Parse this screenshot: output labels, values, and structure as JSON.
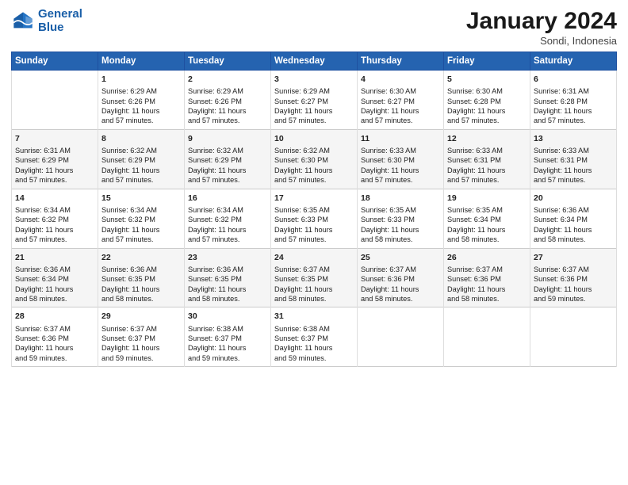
{
  "logo": {
    "line1": "General",
    "line2": "Blue"
  },
  "title": "January 2024",
  "subtitle": "Sondi, Indonesia",
  "days_header": [
    "Sunday",
    "Monday",
    "Tuesday",
    "Wednesday",
    "Thursday",
    "Friday",
    "Saturday"
  ],
  "weeks": [
    [
      {
        "day": "",
        "data": ""
      },
      {
        "day": "1",
        "data": "Sunrise: 6:29 AM\nSunset: 6:26 PM\nDaylight: 11 hours\nand 57 minutes."
      },
      {
        "day": "2",
        "data": "Sunrise: 6:29 AM\nSunset: 6:26 PM\nDaylight: 11 hours\nand 57 minutes."
      },
      {
        "day": "3",
        "data": "Sunrise: 6:29 AM\nSunset: 6:27 PM\nDaylight: 11 hours\nand 57 minutes."
      },
      {
        "day": "4",
        "data": "Sunrise: 6:30 AM\nSunset: 6:27 PM\nDaylight: 11 hours\nand 57 minutes."
      },
      {
        "day": "5",
        "data": "Sunrise: 6:30 AM\nSunset: 6:28 PM\nDaylight: 11 hours\nand 57 minutes."
      },
      {
        "day": "6",
        "data": "Sunrise: 6:31 AM\nSunset: 6:28 PM\nDaylight: 11 hours\nand 57 minutes."
      }
    ],
    [
      {
        "day": "7",
        "data": "Sunrise: 6:31 AM\nSunset: 6:29 PM\nDaylight: 11 hours\nand 57 minutes."
      },
      {
        "day": "8",
        "data": "Sunrise: 6:32 AM\nSunset: 6:29 PM\nDaylight: 11 hours\nand 57 minutes."
      },
      {
        "day": "9",
        "data": "Sunrise: 6:32 AM\nSunset: 6:29 PM\nDaylight: 11 hours\nand 57 minutes."
      },
      {
        "day": "10",
        "data": "Sunrise: 6:32 AM\nSunset: 6:30 PM\nDaylight: 11 hours\nand 57 minutes."
      },
      {
        "day": "11",
        "data": "Sunrise: 6:33 AM\nSunset: 6:30 PM\nDaylight: 11 hours\nand 57 minutes."
      },
      {
        "day": "12",
        "data": "Sunrise: 6:33 AM\nSunset: 6:31 PM\nDaylight: 11 hours\nand 57 minutes."
      },
      {
        "day": "13",
        "data": "Sunrise: 6:33 AM\nSunset: 6:31 PM\nDaylight: 11 hours\nand 57 minutes."
      }
    ],
    [
      {
        "day": "14",
        "data": "Sunrise: 6:34 AM\nSunset: 6:32 PM\nDaylight: 11 hours\nand 57 minutes."
      },
      {
        "day": "15",
        "data": "Sunrise: 6:34 AM\nSunset: 6:32 PM\nDaylight: 11 hours\nand 57 minutes."
      },
      {
        "day": "16",
        "data": "Sunrise: 6:34 AM\nSunset: 6:32 PM\nDaylight: 11 hours\nand 57 minutes."
      },
      {
        "day": "17",
        "data": "Sunrise: 6:35 AM\nSunset: 6:33 PM\nDaylight: 11 hours\nand 57 minutes."
      },
      {
        "day": "18",
        "data": "Sunrise: 6:35 AM\nSunset: 6:33 PM\nDaylight: 11 hours\nand 58 minutes."
      },
      {
        "day": "19",
        "data": "Sunrise: 6:35 AM\nSunset: 6:34 PM\nDaylight: 11 hours\nand 58 minutes."
      },
      {
        "day": "20",
        "data": "Sunrise: 6:36 AM\nSunset: 6:34 PM\nDaylight: 11 hours\nand 58 minutes."
      }
    ],
    [
      {
        "day": "21",
        "data": "Sunrise: 6:36 AM\nSunset: 6:34 PM\nDaylight: 11 hours\nand 58 minutes."
      },
      {
        "day": "22",
        "data": "Sunrise: 6:36 AM\nSunset: 6:35 PM\nDaylight: 11 hours\nand 58 minutes."
      },
      {
        "day": "23",
        "data": "Sunrise: 6:36 AM\nSunset: 6:35 PM\nDaylight: 11 hours\nand 58 minutes."
      },
      {
        "day": "24",
        "data": "Sunrise: 6:37 AM\nSunset: 6:35 PM\nDaylight: 11 hours\nand 58 minutes."
      },
      {
        "day": "25",
        "data": "Sunrise: 6:37 AM\nSunset: 6:36 PM\nDaylight: 11 hours\nand 58 minutes."
      },
      {
        "day": "26",
        "data": "Sunrise: 6:37 AM\nSunset: 6:36 PM\nDaylight: 11 hours\nand 58 minutes."
      },
      {
        "day": "27",
        "data": "Sunrise: 6:37 AM\nSunset: 6:36 PM\nDaylight: 11 hours\nand 59 minutes."
      }
    ],
    [
      {
        "day": "28",
        "data": "Sunrise: 6:37 AM\nSunset: 6:36 PM\nDaylight: 11 hours\nand 59 minutes."
      },
      {
        "day": "29",
        "data": "Sunrise: 6:37 AM\nSunset: 6:37 PM\nDaylight: 11 hours\nand 59 minutes."
      },
      {
        "day": "30",
        "data": "Sunrise: 6:38 AM\nSunset: 6:37 PM\nDaylight: 11 hours\nand 59 minutes."
      },
      {
        "day": "31",
        "data": "Sunrise: 6:38 AM\nSunset: 6:37 PM\nDaylight: 11 hours\nand 59 minutes."
      },
      {
        "day": "",
        "data": ""
      },
      {
        "day": "",
        "data": ""
      },
      {
        "day": "",
        "data": ""
      }
    ]
  ]
}
